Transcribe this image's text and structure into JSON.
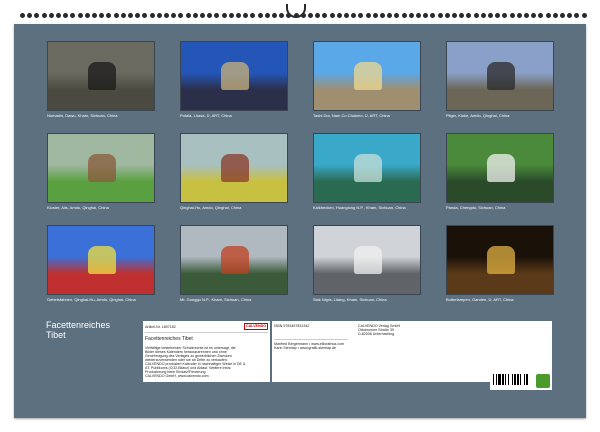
{
  "tiles": [
    {
      "caption": "Nomadin, Dawu, Kham, Sichuan, China",
      "sky": "#6b6a60",
      "ground": "#4a4a40",
      "accent": "#1a1a1a"
    },
    {
      "caption": "Potala, Lhasa, Ü, ART, China",
      "sky": "#2456b8",
      "ground": "#2b2f4a",
      "accent": "#c9b27a"
    },
    {
      "caption": "Tashi Dor, Nam Co Chukmo, Ü, ART, China",
      "sky": "#5aa8e8",
      "ground": "#a08e70",
      "accent": "#f0d890"
    },
    {
      "caption": "Pilger, Kloke, Amdo, Qinghai, China",
      "sky": "#8aa0c8",
      "ground": "#6c6656",
      "accent": "#2a2a2a"
    },
    {
      "caption": "Kloster, Alis, Amdo, Qinghai, China",
      "sky": "#a0b8a0",
      "ground": "#5aa040",
      "accent": "#8a5a3a"
    },
    {
      "caption": "Qinghai-Hu, Amdo, Qinghai, China",
      "sky": "#a8c0c0",
      "ground": "#c8c040",
      "accent": "#8a3a2a"
    },
    {
      "caption": "Kalkbecken, Huanglong N.P., Kham, Sichuan, China",
      "sky": "#3aa8c8",
      "ground": "#2a6a50",
      "accent": "#c8e0d8"
    },
    {
      "caption": "Panda, Chengdu, Sichuan, China",
      "sky": "#4a8a3a",
      "ground": "#2a4a2a",
      "accent": "#f0f0f0"
    },
    {
      "caption": "Gebetsfahnen, Qinghai-Hu, Amdo, Qinghai, China",
      "sky": "#3a70d8",
      "ground": "#c03030",
      "accent": "#f0e040"
    },
    {
      "caption": "Mt. Gonggo N.P., Kham, Sichuan, China",
      "sky": "#b0b8c0",
      "ground": "#3a5a3a",
      "accent": "#c04020"
    },
    {
      "caption": "Siak Nigra, Litang, Kham, Sichuan, China",
      "sky": "#d0d4d8",
      "ground": "#606468",
      "accent": "#f0f0f0"
    },
    {
      "caption": "Butterlampen, Ganden, Ü, ART, China",
      "sky": "#1a1208",
      "ground": "#5a3a18",
      "accent": "#e0b040"
    }
  ],
  "title_line1": "Facettenreiches",
  "title_line2": "Tibet",
  "panel": {
    "artikel": "Artikel-Nr. 1807182",
    "logo": "CALVENDO",
    "name": "Facettenreiches Tibet",
    "body_lines": [
      "Vielfältige bestehender Schutzrechte ist es untersagt, die",
      "Bilder dieses Kalenders herauszutrennen und ohne",
      "Genehmigung des Verlages zu gewerblichen Zwecken",
      "wiederzuverwenden oder sie an Dritte zu verkaufen.",
      "CALVENDO produziert Kalender in nachhaltiger Weise in DE &",
      "AT. Publikums (CO2-Bilanz) und Ablauf. Weitere Infos:",
      "Produzierung beim Einsatz/Förderung",
      "CALVENDO GmbH, www.calvendo.com"
    ]
  },
  "panel_b": {
    "isbn": "ISBN 9783457831342",
    "publisher_lines": [
      "CALVENDO Verlag GmbH",
      "Ottobrunner Straße 39",
      "D-82008 Unterhaching"
    ],
    "author_lines": [
      "Manfred Bergermann • www.elliorafrica.com",
      "Karin Stemlap • www.grafik-stemlap.de"
    ]
  },
  "colors": {
    "sheet": "#5c7080",
    "frame": "#394651"
  }
}
